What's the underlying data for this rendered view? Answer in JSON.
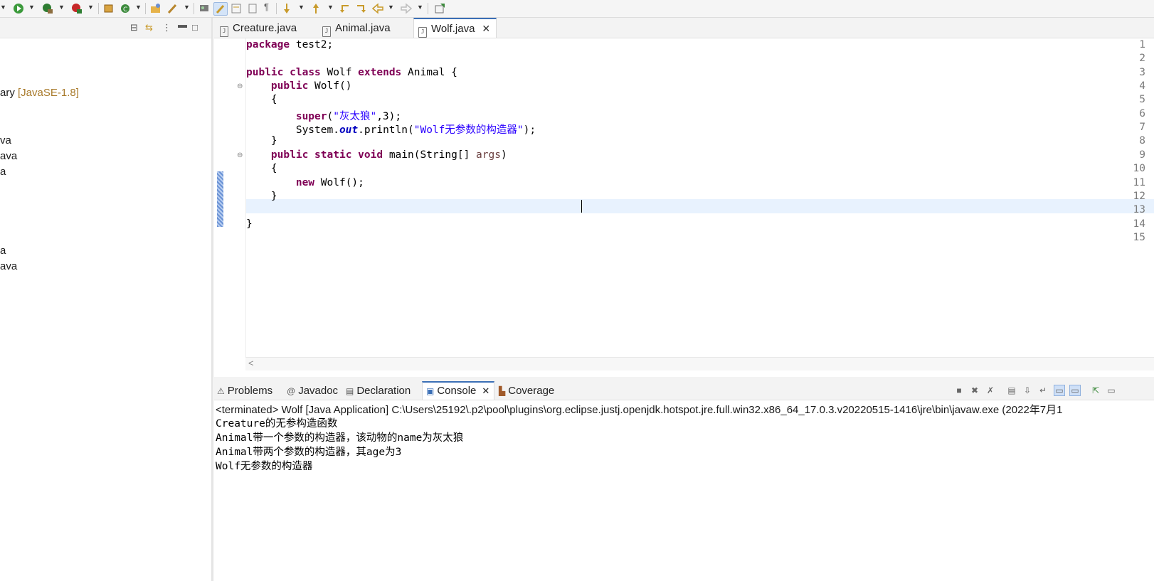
{
  "editor": {
    "tabs": [
      {
        "label": "Creature.java"
      },
      {
        "label": "Animal.java"
      },
      {
        "label": "Wolf.java"
      }
    ],
    "line_numbers": [
      "1",
      "2",
      "3",
      "4",
      "5",
      "6",
      "7",
      "8",
      "9",
      "10",
      "11",
      "12",
      "13",
      "14",
      "15"
    ],
    "code": {
      "l1_kw": "package",
      "l1_rest": " test2;",
      "l3_kw1": "public",
      "l3_kw2": "class",
      "l3_name": " Wolf ",
      "l3_kw3": "extends",
      "l3_rest": " Animal {",
      "l4_kw": "public",
      "l4_rest": " Wolf()",
      "l5": "{",
      "l6_kw": "super",
      "l6_p1": "(",
      "l6_str": "\"灰太狼\"",
      "l6_rest": ",3);",
      "l7_a": "System.",
      "l7_fld": "out",
      "l7_b": ".println(",
      "l7_str": "\"Wolf无参数的构造器\"",
      "l7_c": ");",
      "l8": "}",
      "l9_kw1": "public",
      "l9_kw2": "static",
      "l9_kw3": "void",
      "l9_rest": " main(String[] ",
      "l9_par": "args",
      "l9_end": ")",
      "l10": "{",
      "l11_kw": "new",
      "l11_rest": " Wolf();",
      "l12": "}",
      "l14": "}"
    }
  },
  "package_explorer": {
    "items": [
      {
        "prefix": "ary ",
        "suffix": "[JavaSE-1.8]"
      },
      {
        "text": "va"
      },
      {
        "text": "ava"
      },
      {
        "text": "a"
      },
      {
        "text": "a"
      },
      {
        "text": "ava"
      }
    ]
  },
  "console_view": {
    "tabs": [
      "Problems",
      "Javadoc",
      "Declaration",
      "Console",
      "Coverage"
    ],
    "terminated": "<terminated> Wolf [Java Application] C:\\Users\\25192\\.p2\\pool\\plugins\\org.eclipse.justj.openjdk.hotspot.jre.full.win32.x86_64_17.0.3.v20220515-1416\\jre\\bin\\javaw.exe  (2022年7月1",
    "output": [
      "Creature的无参构造函数",
      "Animal带一个参数的构造器，该动物的name为灰太狼",
      "Animal带两个参数的构造器，其age为3",
      "Wolf无参数的构造器"
    ]
  },
  "icons": {
    "run": "run-icon",
    "debug": "debug-icon",
    "coverage": "coverage-icon",
    "search": "search-icon",
    "close": "close-icon"
  }
}
